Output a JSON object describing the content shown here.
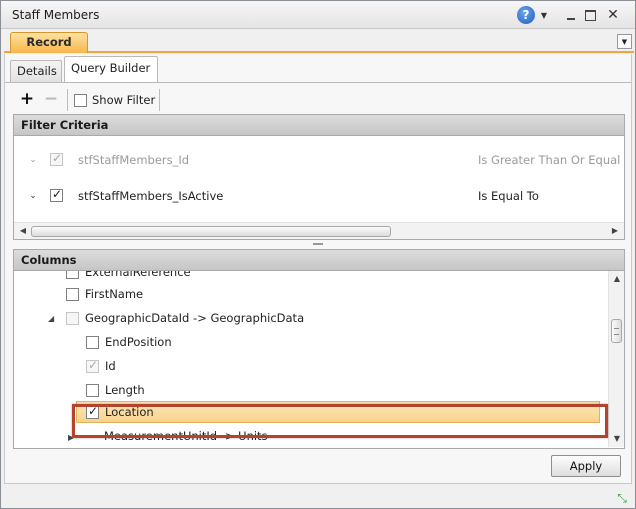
{
  "window": {
    "title": "Staff Members"
  },
  "record_tab": {
    "label": "Record"
  },
  "subtabs": [
    {
      "label": "Details"
    },
    {
      "label": "Query Builder"
    }
  ],
  "toolbar": {
    "show_filter_label": "Show Filter"
  },
  "filter_criteria": {
    "header": "Filter Criteria",
    "rows": [
      {
        "field": "stfStaffMembers_Id",
        "operator": "Is Greater Than Or Equal",
        "checked": true,
        "enabled": false
      },
      {
        "field": "stfStaffMembers_IsActive",
        "operator": "Is Equal To",
        "checked": true,
        "enabled": true
      }
    ]
  },
  "columns": {
    "header": "Columns",
    "items": [
      {
        "label": "ExternalReference",
        "checked": false
      },
      {
        "label": "FirstName",
        "checked": false
      },
      {
        "label": "GeographicDataId -> GeographicData",
        "checked": false,
        "expanded": true
      },
      {
        "label": "EndPosition",
        "checked": false
      },
      {
        "label": "Id",
        "checked": true,
        "enabled": false
      },
      {
        "label": "Length",
        "checked": false
      },
      {
        "label": "Location",
        "checked": true,
        "selected": true
      },
      {
        "label": "MeasurementUnitId -> Units",
        "checked": false,
        "expanded": false
      }
    ]
  },
  "apply_button": {
    "label": "Apply"
  },
  "colors": {
    "accent_orange": "#f7b64b",
    "highlight_border": "#b3432d",
    "selection_fill": "#f9d28a"
  },
  "icons": [
    "help-icon",
    "dropdown-icon",
    "minimize-icon",
    "maximize-icon",
    "close-icon",
    "plus-icon",
    "minus-icon",
    "chevron-down-icon",
    "expand-arrow-icon",
    "resize-grip-icon"
  ]
}
